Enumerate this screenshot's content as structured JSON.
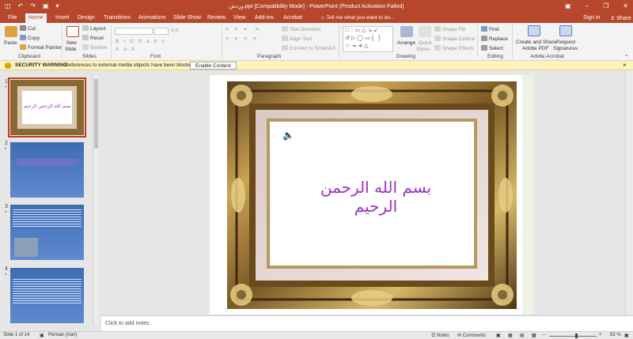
{
  "titlebar": {
    "title": "وردش.ppt [Compatibility Mode] - PowerPoint (Product Activation Failed)",
    "qat": [
      "save-icon",
      "undo-icon",
      "redo-icon",
      "present-icon",
      "customize-icon"
    ],
    "window_buttons": [
      "ribbon-display-icon",
      "minimize-icon",
      "restore-icon",
      "close-icon"
    ]
  },
  "tabs": {
    "items": [
      "File",
      "Home",
      "Insert",
      "Design",
      "Transitions",
      "Animations",
      "Slide Show",
      "Review",
      "View",
      "Add-ins",
      "Acrobat"
    ],
    "active": "Home",
    "tell_me": "Tell me what you want to do...",
    "sign_in": "Sign in",
    "share": "Share"
  },
  "ribbon": {
    "clipboard": {
      "paste": "Paste",
      "cut": "Cut",
      "copy": "Copy",
      "format_painter": "Format Painter",
      "label": "Clipboard"
    },
    "slides": {
      "new_slide": "New",
      "new_slide2": "Slide",
      "layout": "Layout",
      "reset": "Reset",
      "section": "Section",
      "label": "Slides"
    },
    "font": {
      "label": "Font"
    },
    "paragraph": {
      "text_direction": "Text Direction",
      "align_text": "Align Text",
      "smartart": "Convert to SmartArt",
      "label": "Paragraph"
    },
    "drawing": {
      "arrange": "Arrange",
      "quick_styles": "Quick",
      "quick_styles2": "Styles",
      "shape_fill": "Shape Fill",
      "shape_outline": "Shape Outline",
      "shape_effects": "Shape Effects",
      "label": "Drawing"
    },
    "editing": {
      "find": "Find",
      "replace": "Replace",
      "select": "Select",
      "label": "Editing"
    },
    "acrobat": {
      "create_share": "Create and Share",
      "create_share2": "Adobe PDF",
      "request": "Request",
      "request2": "Signatures",
      "label": "Adobe Acrobat"
    }
  },
  "security_bar": {
    "title": "SECURITY WARNING",
    "message": "References to external media objects have been blocked",
    "button": "Enable Content"
  },
  "thumbnails": [
    {
      "num": "1",
      "star": "*",
      "text": "بسم الله الرحمن الرحيم"
    },
    {
      "num": "2",
      "star": "*"
    },
    {
      "num": "3",
      "star": "*"
    },
    {
      "num": "4",
      "star": "*"
    }
  ],
  "slide": {
    "text": "بسم الله الرحمن الرحيم",
    "text_color": "#9b30c8"
  },
  "notes": {
    "placeholder": "Click to add notes"
  },
  "status": {
    "slide_info": "Slide 1 of 14",
    "language": "Persian (Iran)",
    "notes": "Notes",
    "comments": "Comments",
    "zoom": "82 %"
  },
  "colors": {
    "accent": "#b7472a",
    "security_bg": "#fcf3bf"
  }
}
